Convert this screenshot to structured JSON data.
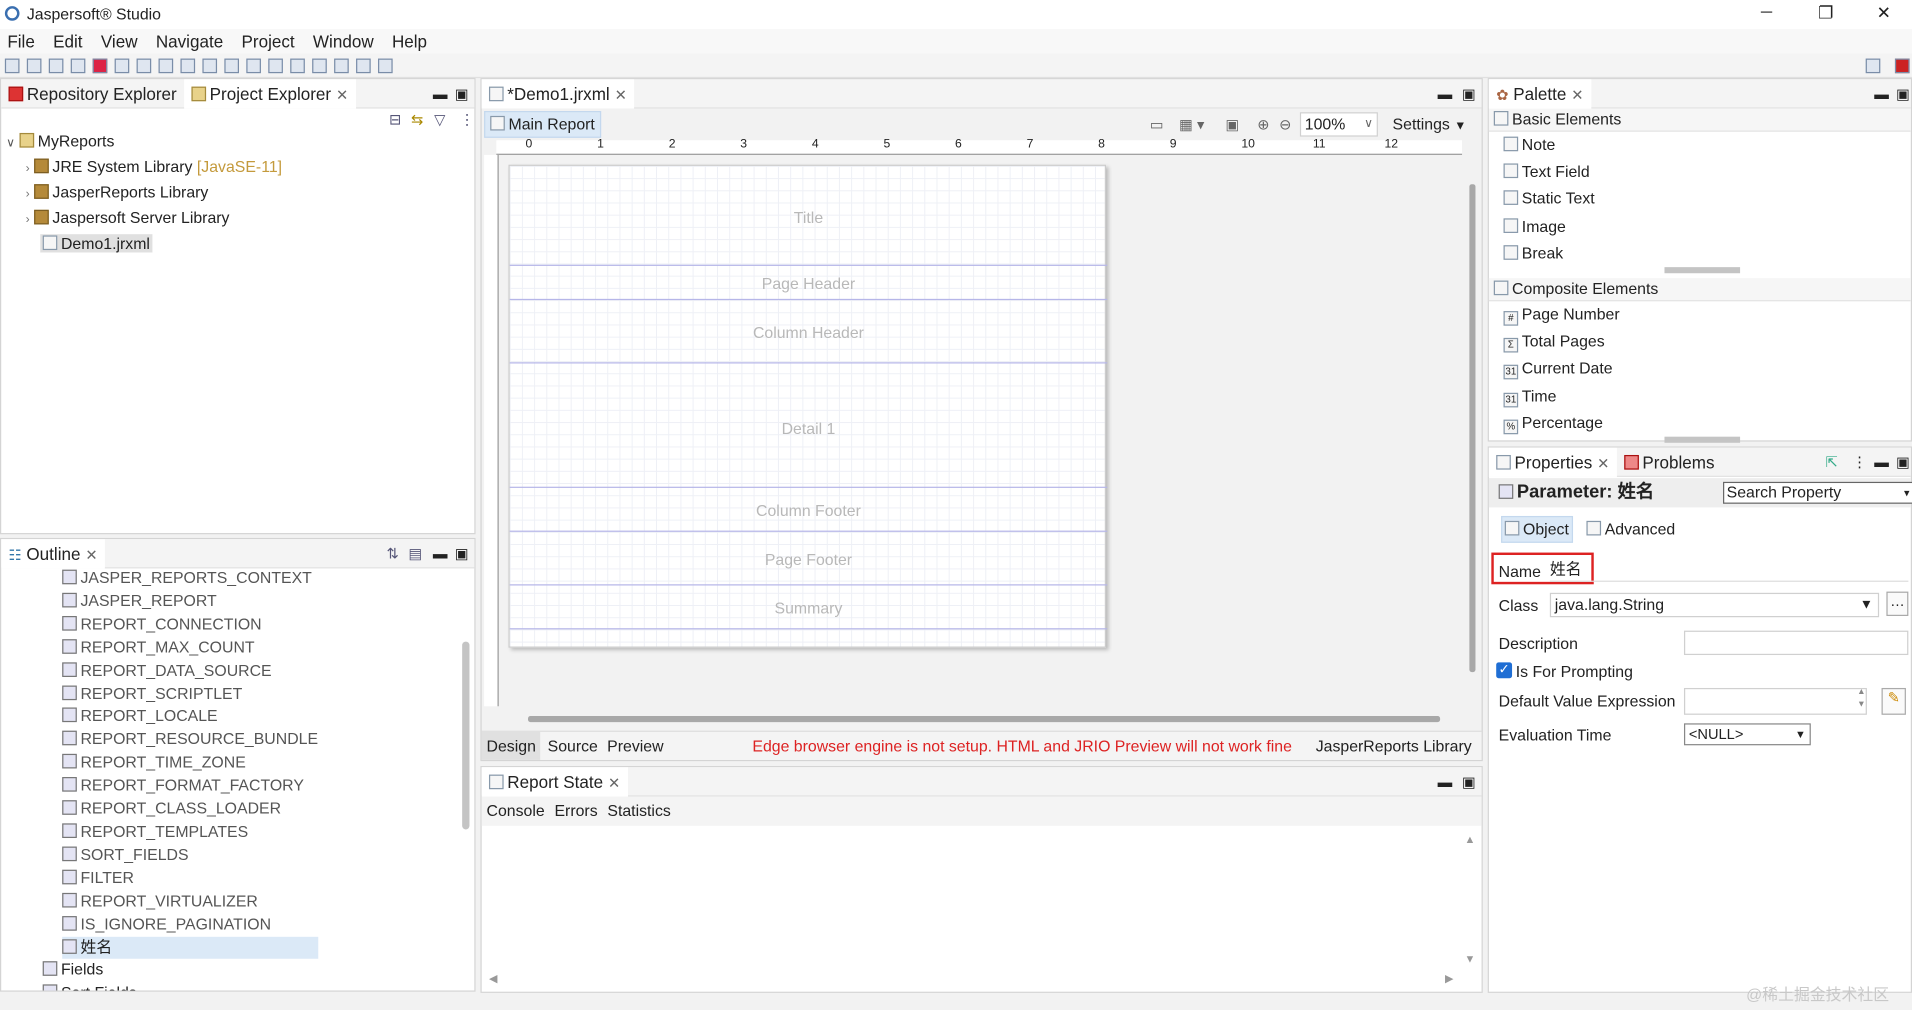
{
  "app": {
    "title": "Jaspersoft® Studio",
    "controls": {
      "minimize": "─",
      "restore": "❐",
      "close": "✕"
    }
  },
  "menu": [
    "File",
    "Edit",
    "View",
    "Navigate",
    "Project",
    "Window",
    "Help"
  ],
  "left": {
    "tabs": [
      {
        "label": "Repository Explorer",
        "icon": "repository-icon"
      },
      {
        "label": "Project Explorer",
        "icon": "project-icon"
      }
    ],
    "tree": {
      "root": "MyReports",
      "items": [
        {
          "label": "JRE System Library",
          "suffix": "[JavaSE-11]",
          "icon": "library-icon"
        },
        {
          "label": "JasperReports Library",
          "suffix": "",
          "icon": "library-icon"
        },
        {
          "label": "Jaspersoft Server Library",
          "suffix": "",
          "icon": "library-icon"
        },
        {
          "label": "Demo1.jrxml",
          "suffix": "",
          "icon": "report-file-icon"
        }
      ]
    }
  },
  "outline": {
    "tab": "Outline",
    "params": [
      "JASPER_REPORTS_CONTEXT",
      "JASPER_REPORT",
      "REPORT_CONNECTION",
      "REPORT_MAX_COUNT",
      "REPORT_DATA_SOURCE",
      "REPORT_SCRIPTLET",
      "REPORT_LOCALE",
      "REPORT_RESOURCE_BUNDLE",
      "REPORT_TIME_ZONE",
      "REPORT_FORMAT_FACTORY",
      "REPORT_CLASS_LOADER",
      "REPORT_TEMPLATES",
      "SORT_FIELDS",
      "FILTER",
      "REPORT_VIRTUALIZER",
      "IS_IGNORE_PAGINATION",
      "姓名"
    ],
    "groups": [
      "Fields",
      "Sort Fields"
    ]
  },
  "editor": {
    "tab": "*Demo1.jrxml",
    "subtab": "Main Report",
    "zoom": "100%",
    "settings": "Settings",
    "ruler": [
      "0",
      "1",
      "2",
      "3",
      "4",
      "5",
      "6",
      "7",
      "8",
      "9",
      "10",
      "11",
      "12"
    ],
    "bands": [
      "Title",
      "Page Header",
      "Column Header",
      "Detail 1",
      "Column Footer",
      "Page Footer",
      "Summary"
    ],
    "bottom_tabs": [
      "Design",
      "Source",
      "Preview"
    ],
    "warning": "Edge browser engine is not setup. HTML and JRIO Preview will not work fine",
    "library": "JasperReports Library"
  },
  "report_state": {
    "tab": "Report State",
    "subtabs": [
      "Console",
      "Errors",
      "Statistics"
    ]
  },
  "palette": {
    "tab": "Palette",
    "basic_title": "Basic Elements",
    "basic": [
      {
        "label": "Note",
        "icon": "note-icon"
      },
      {
        "label": "Text Field",
        "icon": "text-field-icon"
      },
      {
        "label": "Static Text",
        "icon": "static-text-icon"
      },
      {
        "label": "Image",
        "icon": "image-icon"
      },
      {
        "label": "Break",
        "icon": "break-icon"
      }
    ],
    "composite_title": "Composite Elements",
    "composite": [
      {
        "label": "Page Number",
        "icon": "page-number-icon",
        "glyph": "#"
      },
      {
        "label": "Total Pages",
        "icon": "total-pages-icon",
        "glyph": "Σ"
      },
      {
        "label": "Current Date",
        "icon": "current-date-icon",
        "glyph": "31"
      },
      {
        "label": "Time",
        "icon": "time-icon",
        "glyph": "31"
      },
      {
        "label": "Percentage",
        "icon": "percentage-icon",
        "glyph": "%"
      }
    ]
  },
  "properties": {
    "tabs": [
      "Properties",
      "Problems"
    ],
    "heading": "Parameter: 姓名",
    "search": "Search Property",
    "subtabs": [
      "Object",
      "Advanced"
    ],
    "name_label": "Name",
    "name_value": "姓名",
    "class_label": "Class",
    "class_value": "java.lang.String",
    "description_label": "Description",
    "prompting_label": "Is For Prompting",
    "default_label": "Default Value Expression",
    "eval_label": "Evaluation Time",
    "eval_value": "<NULL>"
  },
  "watermark": "@稀土掘金技术社区"
}
